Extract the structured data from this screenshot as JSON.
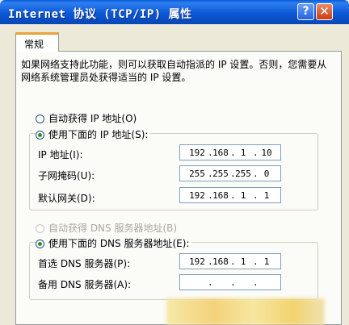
{
  "window": {
    "title": "Internet 协议 (TCP/IP) 属性",
    "help_label": "?",
    "close_label": "✕",
    "icons": {
      "help": "help-icon",
      "close": "close-icon"
    }
  },
  "tabs": [
    {
      "label": "常规",
      "selected": true
    }
  ],
  "description": "如果网络支持此功能，则可以获取自动指派的 IP 设置。否则，您需要从网络系统管理员处获得适当的 IP 设置。",
  "ip_section": {
    "auto_label": "自动获得 IP 地址(O)",
    "manual_label": "使用下面的 IP 地址(S):",
    "selected": "manual",
    "fields": [
      {
        "label": "IP 地址(I):",
        "octets": [
          "192",
          "168",
          "1",
          "10"
        ]
      },
      {
        "label": "子网掩码(U):",
        "octets": [
          "255",
          "255",
          "255",
          "0"
        ]
      },
      {
        "label": "默认网关(D):",
        "octets": [
          "192",
          "168",
          "1",
          "1"
        ]
      }
    ]
  },
  "dns_section": {
    "auto_label": "自动获得 DNS 服务器地址(B)",
    "manual_label": "使用下面的 DNS 服务器地址(E):",
    "selected": "manual",
    "auto_disabled": true,
    "fields": [
      {
        "label": "首选 DNS 服务器(P):",
        "octets": [
          "192",
          "168",
          "1",
          "1"
        ]
      },
      {
        "label": "备用 DNS 服务器(A):",
        "octets": [
          "",
          "",
          "",
          ""
        ]
      }
    ]
  },
  "colors": {
    "titlebar": "#0b58d6",
    "tab_highlight": "#e9a23b",
    "radio_dot": "#2b8f2b"
  }
}
